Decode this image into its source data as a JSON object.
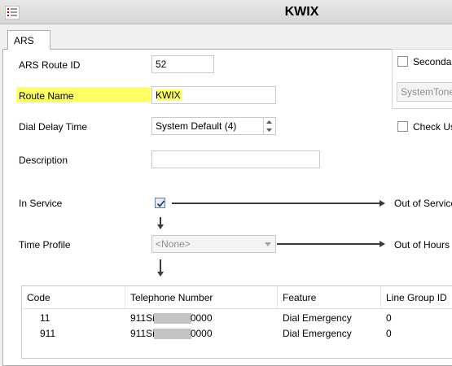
{
  "window": {
    "title": "KWIX"
  },
  "tabs": [
    {
      "label": "ARS"
    }
  ],
  "form": {
    "route_id_label": "ARS Route ID",
    "route_id_value": "52",
    "route_name_label": "Route Name",
    "route_name_value": "KWIX",
    "dial_delay_label": "Dial Delay Time",
    "dial_delay_value": "System Default (4)",
    "description_label": "Description",
    "description_value": "",
    "in_service_label": "In Service",
    "in_service_checked": true,
    "out_of_service_label": "Out of Service",
    "time_profile_label": "Time Profile",
    "time_profile_value": "<None>",
    "out_of_hours_label": "Out of Hours",
    "secondary_label": "Secondar",
    "secondary_tone_value": "SystemTone",
    "check_user_label": "Check Us"
  },
  "table": {
    "headers": [
      "Code",
      "Telephone Number",
      "Feature",
      "Line Group ID"
    ],
    "rows": [
      {
        "code": "11",
        "tel_prefix": "911Si",
        "tel_suffix": "0000",
        "feature": "Dial Emergency",
        "line_group": "0"
      },
      {
        "code": "911",
        "tel_prefix": "911Si",
        "tel_suffix": "0000",
        "feature": "Dial Emergency",
        "line_group": "0"
      }
    ]
  },
  "colors": {
    "highlight": "#ffff66",
    "arrow": "#3a3a3a"
  }
}
